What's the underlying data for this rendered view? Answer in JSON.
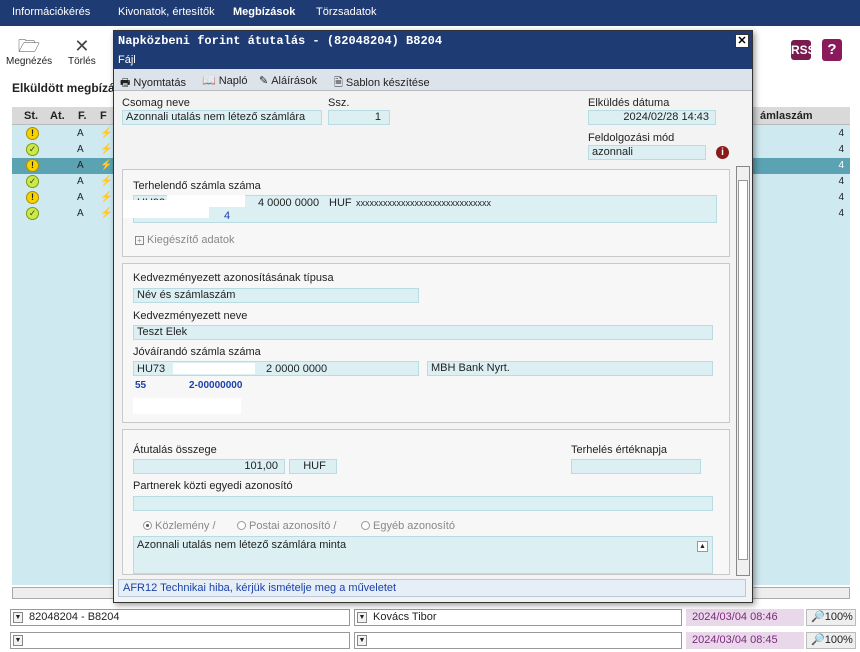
{
  "topmenu": [
    "Információkérés",
    "Kivonatok, értesítők",
    "Megbízások",
    "Törzsadatok"
  ],
  "toolbar": {
    "open_label": "Megnézés",
    "delete_label": "Törlés"
  },
  "list": {
    "title": "Elküldött megbízá",
    "headers": {
      "st": "St.",
      "at": "At.",
      "f": "F.",
      "f2": "F",
      "account": "ámlaszám"
    },
    "rows": [
      {
        "status": "warn",
        "at": "A",
        "num": "4"
      },
      {
        "status": "ok",
        "at": "A",
        "num": "4"
      },
      {
        "status": "warn",
        "at": "A",
        "num": "4"
      },
      {
        "status": "ok",
        "at": "A",
        "num": "4"
      },
      {
        "status": "warn",
        "at": "A",
        "num": "4"
      },
      {
        "status": "ok",
        "at": "A",
        "num": "4"
      }
    ]
  },
  "dialog": {
    "title": "Napközbeni forint átutalás - (82048204) B8204",
    "menu": "Fájl",
    "tools": {
      "print": "Nyomtatás",
      "log": "Napló",
      "signatures": "Aláírások",
      "template": "Sablon készítése"
    },
    "package_name_label": "Csomag neve",
    "package_name": "Azonnali utalás nem létező számlára",
    "seq_label": "Ssz.",
    "seq": "1",
    "sent_date_label": "Elküldés dátuma",
    "sent_date": "2024/02/28 14:43",
    "processing_label": "Feldolgozási mód",
    "processing": "azonnali",
    "debit_label": "Terhelendő számla száma",
    "debit_account_a": "HU93",
    "debit_account_b": "4 0000 0000",
    "debit_currency": "HUF",
    "debit_x": "xxxxxxxxxxxxxxxxxxxxxxxxxxxxxx",
    "debit_suffix": "4",
    "extra_label": "Kiegészítő adatok",
    "benef_id_type_label": "Kedvezményezett azonosításának típusa",
    "benef_id_type": "Név és számlaszám",
    "benef_name_label": "Kedvezményezett neve",
    "benef_name": "Teszt Elek",
    "credit_label": "Jóváírandó számla száma",
    "credit_account_a": "HU73",
    "credit_account_b": "2 0000 0000",
    "credit_bank": "MBH Bank Nyrt.",
    "credit_line2_a": "55",
    "credit_line2_b": "2-00000000",
    "amount_label": "Átutalás összege",
    "amount": "101,00",
    "currency": "HUF",
    "value_date_label": "Terhelés értéknapja",
    "partner_id_label": "Partnerek közti egyedi azonosító",
    "radio_1": "Közlemény /",
    "radio_2": "Postai azonosító /",
    "radio_3": "Egyéb azonosító",
    "remark": "Azonnali utalás nem létező számlára minta",
    "message": "AFR12 Technikai hiba, kérjük ismételje meg a műveletet"
  },
  "status1": {
    "left": "82048204 - B8204",
    "user": "Kovács Tibor",
    "date": "2024/03/04 08:46",
    "zoom": "100%"
  },
  "status2": {
    "date": "2024/03/04 08:45",
    "zoom": "100%"
  }
}
